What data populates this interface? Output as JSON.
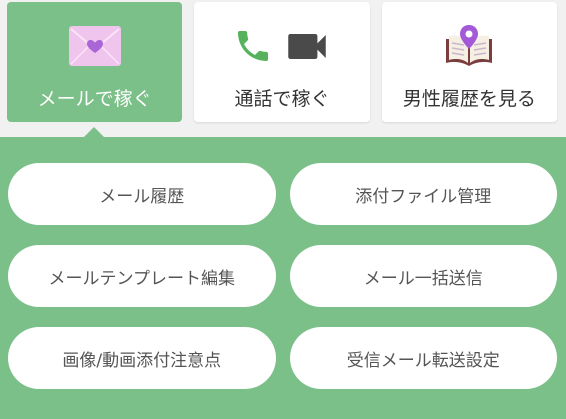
{
  "tabs": [
    {
      "label": "メールで稼ぐ",
      "icon": "envelope-heart-icon",
      "selected": true
    },
    {
      "label": "通話で稼ぐ",
      "icons": [
        "phone-icon",
        "video-camera-icon"
      ],
      "selected": false
    },
    {
      "label": "男性履歴を見る",
      "icon": "book-map-pin-icon",
      "selected": false
    }
  ],
  "menu": {
    "items": [
      "メール履歴",
      "添付ファイル管理",
      "メールテンプレート編集",
      "メール一括送信",
      "画像/動画添付注意点",
      "受信メール転送設定"
    ]
  },
  "colors": {
    "accent": "#7bbf89",
    "page_bg": "#f1f1f1",
    "card_bg": "#ffffff",
    "tab_text": "#333333",
    "button_text": "#555555",
    "envelope": "#efc5ee",
    "heart": "#a866d6",
    "phone": "#56b35c",
    "camera": "#4a4a4a",
    "book_cover": "#7b3e3e",
    "pin": "#a45ad6"
  }
}
